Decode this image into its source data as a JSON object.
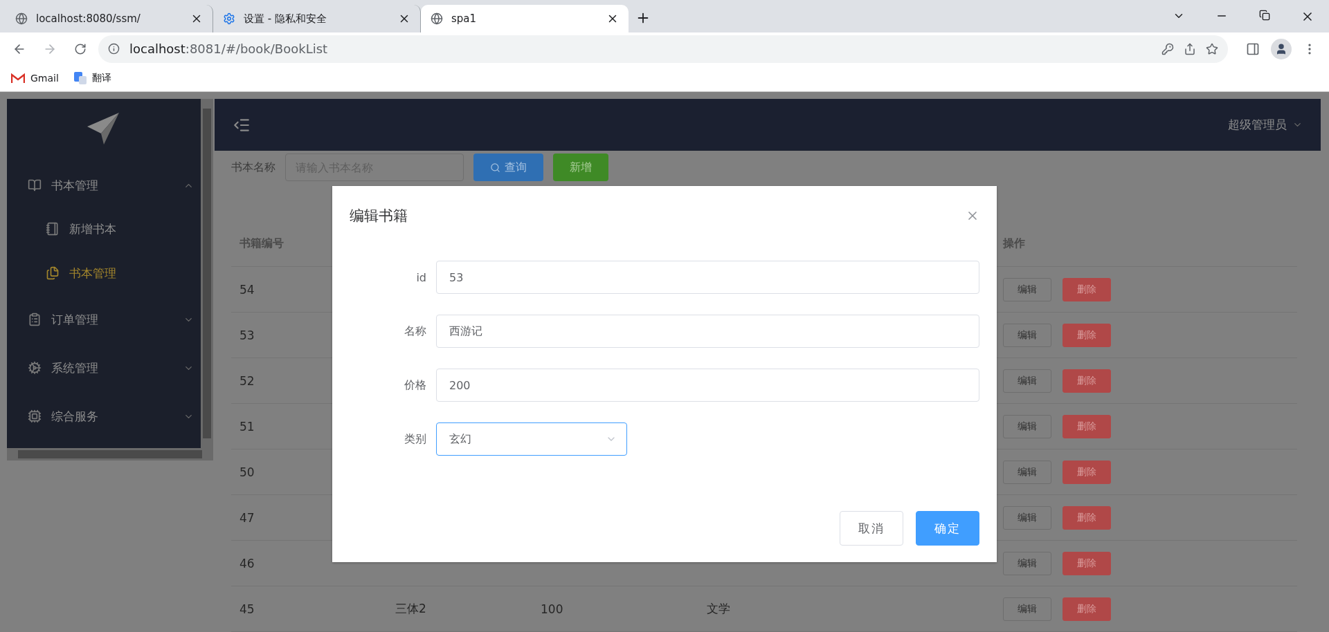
{
  "browser": {
    "tabs": [
      {
        "title": "localhost:8080/ssm/",
        "selected": false
      },
      {
        "title": "设置 - 隐私和安全",
        "selected": false
      },
      {
        "title": "spa1",
        "selected": true
      }
    ],
    "address": {
      "host": "localhost",
      "rest": ":8081/#/book/BookList"
    },
    "bookmarks": [
      {
        "label": "Gmail"
      },
      {
        "label": "翻译"
      }
    ]
  },
  "sidebar": {
    "menu": [
      {
        "label": "书本管理",
        "expanded": true,
        "children": [
          {
            "label": "新增书本",
            "selected": false
          },
          {
            "label": "书本管理",
            "selected": true
          }
        ]
      },
      {
        "label": "订单管理",
        "expanded": false
      },
      {
        "label": "系统管理",
        "expanded": false
      },
      {
        "label": "综合服务",
        "expanded": false
      }
    ]
  },
  "header": {
    "user": "超级管理员"
  },
  "toolbar": {
    "label": "书本名称",
    "placeholder": "请输入书本名称",
    "buttons": [
      {
        "label": "查询",
        "kind": "primary"
      },
      {
        "label": "新增",
        "kind": "success"
      }
    ]
  },
  "table": {
    "columns": [
      {
        "label": "书籍编号",
        "kind": "text"
      },
      {
        "label": "操作",
        "kind": "actions"
      }
    ],
    "rows": [
      {
        "cells": [
          "54"
        ],
        "actions": [
          "编辑",
          "删除"
        ]
      },
      {
        "cells": [
          "53"
        ],
        "actions": [
          "编辑",
          "删除"
        ]
      },
      {
        "cells": [
          "52"
        ],
        "actions": [
          "编辑",
          "删除"
        ]
      },
      {
        "cells": [
          "51"
        ],
        "actions": [
          "编辑",
          "删除"
        ]
      },
      {
        "cells": [
          "50"
        ],
        "actions": [
          "编辑",
          "删除"
        ]
      },
      {
        "cells": [
          "47"
        ],
        "actions": [
          "编辑",
          "删除"
        ]
      },
      {
        "cells": [
          "46"
        ],
        "actions": [
          "编辑",
          "删除"
        ]
      },
      {
        "cells": [
          "45",
          "三体2",
          "100",
          "文学"
        ],
        "actions": [
          "编辑",
          "删除"
        ]
      }
    ]
  },
  "dialog": {
    "title": "编辑书籍",
    "fields": [
      {
        "label": "id",
        "value": "53",
        "kind": "input",
        "focused": false
      },
      {
        "label": "名称",
        "value": "西游记",
        "kind": "input",
        "focused": false
      },
      {
        "label": "价格",
        "value": "200",
        "kind": "input",
        "focused": false
      },
      {
        "label": "类别",
        "value": "玄幻",
        "kind": "select",
        "focused": true
      }
    ],
    "buttons": [
      {
        "label": "取消",
        "kind": "default"
      },
      {
        "label": "确定",
        "kind": "primary"
      }
    ]
  }
}
